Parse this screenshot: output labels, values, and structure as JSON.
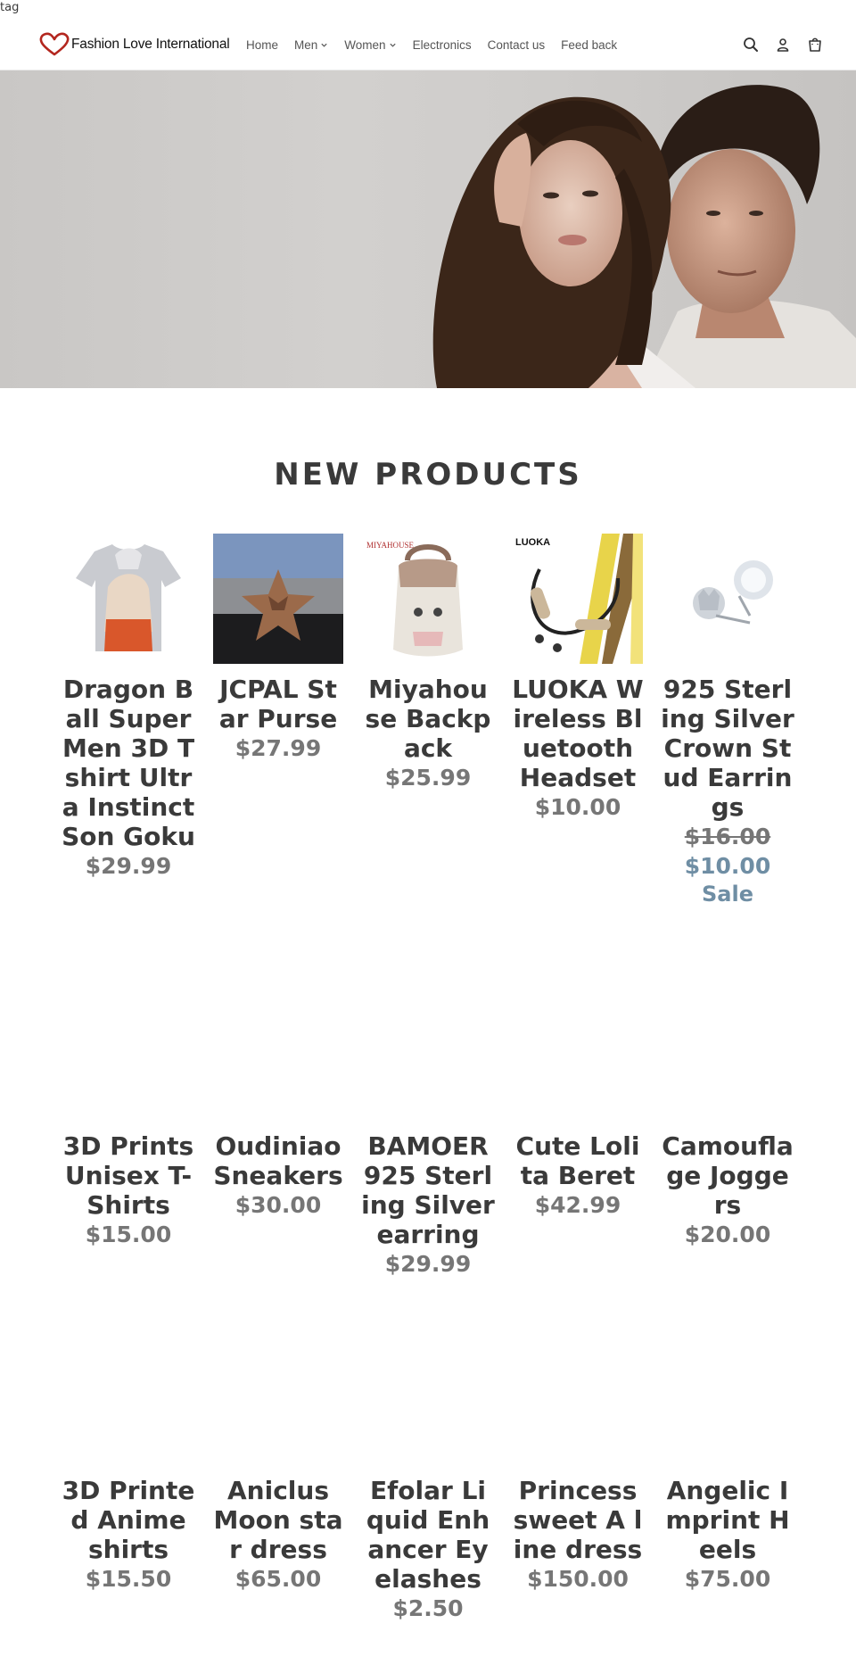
{
  "top_tag": "tag",
  "header": {
    "logo_text": "Fashion Love International",
    "nav": [
      {
        "label": "Home"
      },
      {
        "label": "Men"
      },
      {
        "label": "Women"
      },
      {
        "label": "Electronics"
      },
      {
        "label": "Contact us"
      },
      {
        "label": "Feed back"
      }
    ],
    "icons": [
      "search-icon",
      "account-icon",
      "cart-icon"
    ]
  },
  "section": {
    "title": "NEW PRODUCTS"
  },
  "products_row1": [
    {
      "title": "Dragon Ball Super Men 3D T shirt Ultra Instinct Son Goku",
      "price": "$29.99"
    },
    {
      "title": "JCPAL Star Purse",
      "price": "$27.99"
    },
    {
      "title": "Miyahouse Backpack",
      "price": "$25.99",
      "image_caption": "MIYAHOUSE"
    },
    {
      "title": "LUOKA Wireless Bluetooth Headset",
      "price": "$10.00",
      "image_caption": "LUOKA"
    },
    {
      "title": "925 Sterling Silver Crown Stud Earrings",
      "price_old": "$16.00",
      "price": "$10.00",
      "sale_label": "Sale"
    }
  ],
  "products_row2": [
    {
      "title": "3D Prints Unisex T-Shirts",
      "price": "$15.00"
    },
    {
      "title": "Oudiniao Sneakers",
      "price": "$30.00"
    },
    {
      "title": "BAMOER 925 Sterling Silver earring",
      "price": "$29.99"
    },
    {
      "title": "Cute Lolita Beret",
      "price": "$42.99"
    },
    {
      "title": "Camouflage Joggers",
      "price": "$20.00"
    }
  ],
  "products_row3": [
    {
      "title": "3D Printed Anime shirts",
      "price": "$15.50"
    },
    {
      "title": "Aniclus Moon star dress",
      "price": "$65.00"
    },
    {
      "title": "Efolar Liquid Enhancer Eyelashes",
      "price": "$2.50"
    },
    {
      "title": "Princess sweet A line dress",
      "price": "$150.00"
    },
    {
      "title": "Angelic Imprint Heels",
      "price": "$75.00"
    }
  ],
  "colors": {
    "text": "#3a3a3a",
    "price": "#767676",
    "sale": "#6f8ea4",
    "logo_heart": "#b3261e"
  }
}
